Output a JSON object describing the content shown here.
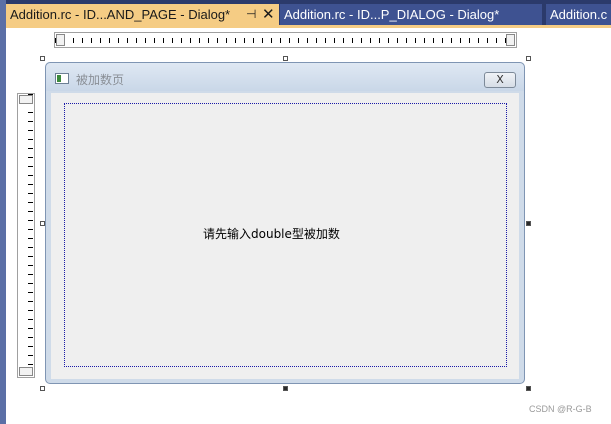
{
  "tabs": [
    {
      "label": "Addition.rc - ID...AND_PAGE - Dialog*",
      "active": true,
      "pin_icon": "pin-icon",
      "close_icon": "close-icon"
    },
    {
      "label": "Addition.rc - ID...P_DIALOG - Dialog*",
      "active": false
    },
    {
      "label": "Addition.c",
      "active": false
    }
  ],
  "tab_glyphs": {
    "pin": "⊣",
    "close": "✕"
  },
  "dialog": {
    "title": "被加数页",
    "close_glyph": "X",
    "static_text": "请先输入double型被加数"
  },
  "watermark": "CSDN @R-G-B",
  "colors": {
    "tab_active": "#f5cc84",
    "tab_inactive": "#3e5291",
    "tabstrip_bg": "#2b3a6b",
    "dialog_frame": "#cfdbe9",
    "dialog_client": "#efefef",
    "guide_line": "#1a1aa8"
  }
}
